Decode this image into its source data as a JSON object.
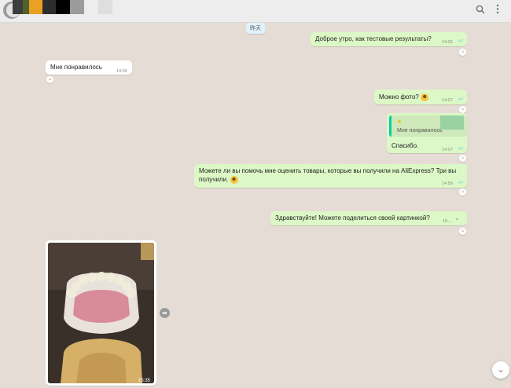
{
  "header": {
    "swatches": [
      "#3d3d3d",
      "#50622c",
      "#e9a024",
      "#2d2d2d",
      "#000000",
      "#9b9b9b",
      "#dedede"
    ],
    "search_icon": "search-icon",
    "menu_icon": "more-vert-icon"
  },
  "chat": {
    "date_label": "昨天",
    "messages": {
      "m1": {
        "text": "Доброе утро, как тестовые результаты?",
        "time": "14:05"
      },
      "m2": {
        "text": "Мне понравилось",
        "time": "14:06"
      },
      "m3": {
        "text": "Можно фото?",
        "time": "14:07"
      },
      "m4": {
        "quote_text": "Мне понравилось",
        "text": "Спасибо.",
        "time": "14:07"
      },
      "m5": {
        "text": "Можете ли вы помочь мне оценить товары, которые вы получили на AliExpress? Три вы получили.",
        "time": "14:59"
      },
      "m6": {
        "text": "Здравствуйте! Можете поделиться своей картинкой?",
        "time": "15:..."
      },
      "m7": {
        "time": "15:35"
      }
    },
    "forward_icon": "forward-icon",
    "scroll_down_icon": "chevron-down-icon"
  },
  "colors": {
    "outgoing_bubble": "#dcf8c6",
    "incoming_bubble": "#ffffff",
    "chat_background": "#e5ddd5",
    "read_ticks": "#4fc3f7"
  }
}
